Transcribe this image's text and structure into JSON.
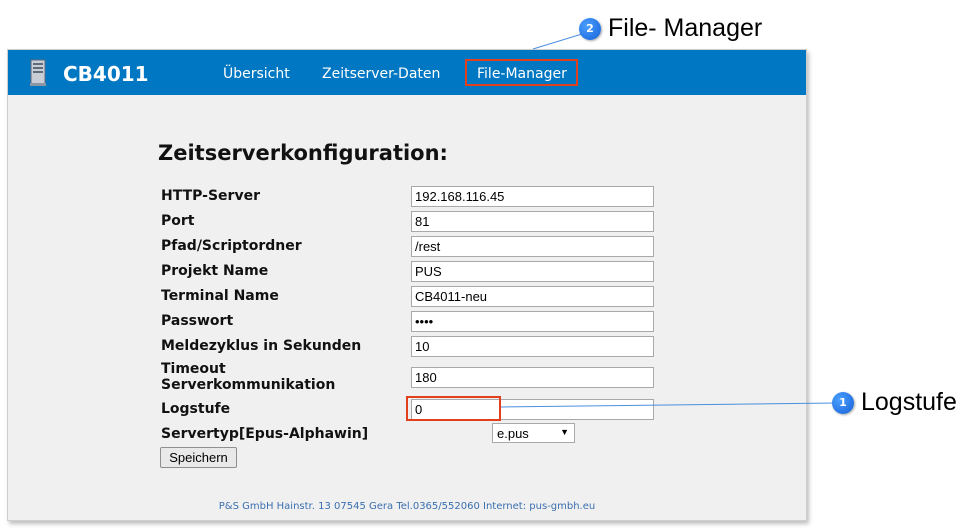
{
  "header": {
    "brand": "CB4011",
    "nav": [
      {
        "label": "Übersicht"
      },
      {
        "label": "Zeitserver-Daten"
      },
      {
        "label": "File-Manager"
      }
    ]
  },
  "form": {
    "title": "Zeitserverkonfiguration:",
    "fields": [
      {
        "label": "HTTP-Server",
        "value": "192.168.116.45"
      },
      {
        "label": "Port",
        "value": "81"
      },
      {
        "label": "Pfad/Scriptordner",
        "value": "/rest"
      },
      {
        "label": "Projekt Name",
        "value": "PUS"
      },
      {
        "label": "Terminal Name",
        "value": "CB4011-neu"
      },
      {
        "label": "Passwort",
        "value": "••••"
      },
      {
        "label": "Meldezyklus in Sekunden",
        "value": "10"
      },
      {
        "label_line1": "Timeout",
        "label_line2": "Serverkommunikation",
        "value": "180"
      },
      {
        "label": "Logstufe",
        "value": "0"
      }
    ],
    "servertyp": {
      "label": "Servertyp[Epus-Alphawin]",
      "selected": "e.pus"
    },
    "save_label": "Speichern"
  },
  "footer": {
    "text": "P&S GmbH Hainstr. 13 07545 Gera Tel.0365/552060 Internet: pus-gmbh.eu"
  },
  "callouts": [
    {
      "number": "1",
      "text": "Logstufe"
    },
    {
      "number": "2",
      "text": "File- Manager"
    }
  ],
  "colors": {
    "navbar": "#0077c2",
    "highlight": "#e0401c",
    "callout_badge": "#1a6fe0"
  }
}
